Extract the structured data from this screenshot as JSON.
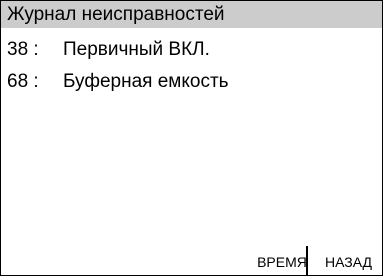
{
  "header": {
    "title": "Журнал неисправностей"
  },
  "faults": [
    {
      "code": "38 :",
      "name": "Первичный ВКЛ."
    },
    {
      "code": "68 :",
      "name": "Буферная емкость"
    }
  ],
  "softkeys": {
    "time_label": "ВРЕМЯ",
    "back_label": "НАЗАД"
  },
  "colors": {
    "title_bar": "#cccccc",
    "background": "#ffffff",
    "text": "#000000"
  }
}
